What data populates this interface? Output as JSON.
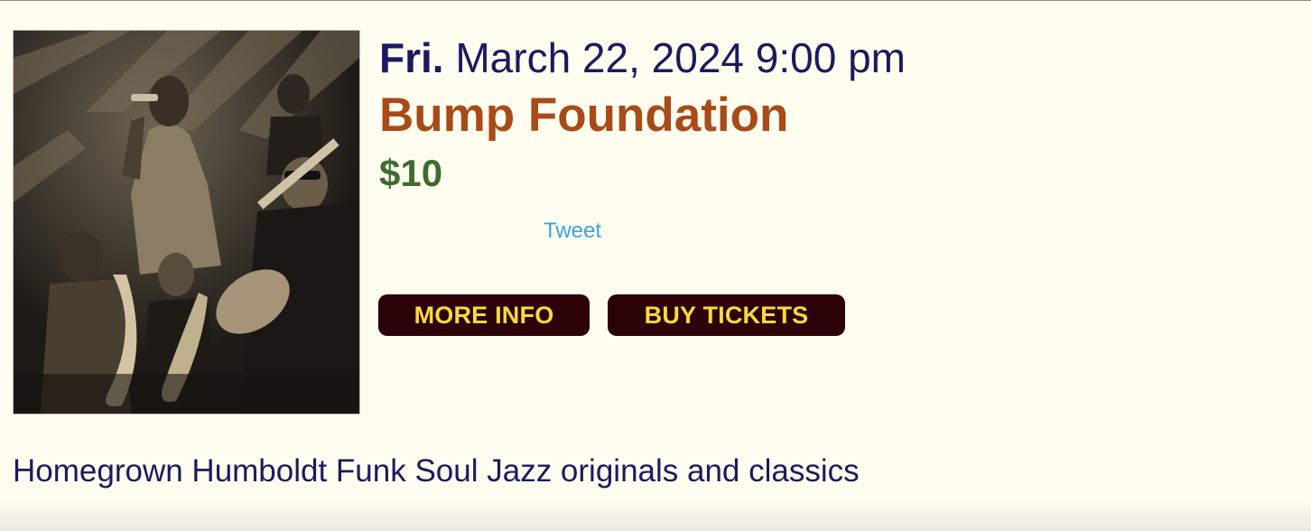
{
  "event": {
    "day_of_week": "Fri.",
    "date_time": "March 22, 2024 9:00 pm",
    "title": "Bump Foundation",
    "price": "$10",
    "tweet_label": "Tweet",
    "buttons": {
      "more_info": "MORE INFO",
      "buy_tickets": "BUY TICKETS"
    },
    "description": "Homegrown Humboldt Funk Soul Jazz originals and classics"
  },
  "colors": {
    "background": "#fffdf0",
    "date_text": "#1c1a5e",
    "title": "#a84b18",
    "price": "#3f6b2f",
    "tweet": "#3aa3e3",
    "button_bg": "#2a0208",
    "button_text": "#ffd93a"
  }
}
